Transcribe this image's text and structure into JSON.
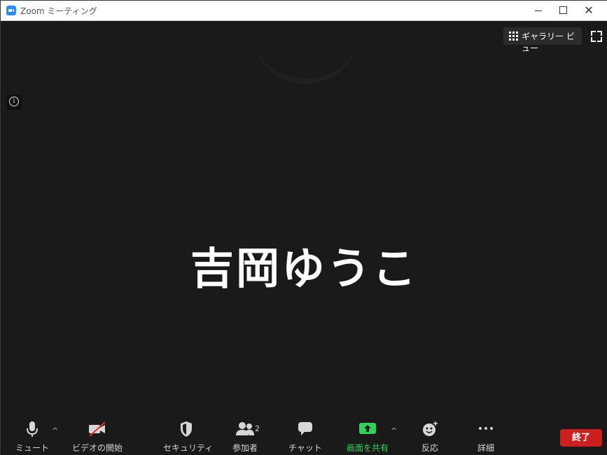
{
  "window": {
    "title": "Zoom ミーティング",
    "close_glyph": "✕"
  },
  "stage": {
    "gallery_view_label": "ギャラリー ビュー",
    "participant_name": "吉岡ゆうこ"
  },
  "toolbar": {
    "mute_label": "ミュート",
    "video_label": "ビデオの開始",
    "security_label": "セキュリティ",
    "participants_label": "参加者",
    "participants_count": "2",
    "chat_label": "チャット",
    "share_label": "画面を共有",
    "reactions_label": "反応",
    "more_label": "詳細",
    "end_label": "終了",
    "caret": "^"
  },
  "colors": {
    "share_green": "#2ed15a",
    "end_red": "#cc1f1f",
    "accent_blue": "#2d8cff"
  }
}
